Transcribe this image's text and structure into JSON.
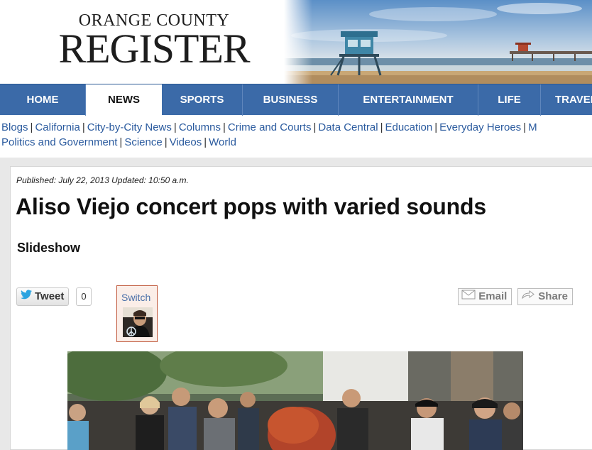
{
  "masthead": {
    "logo_top": "ORANGE COUNTY",
    "logo_bottom": "REGISTER"
  },
  "nav": {
    "items": [
      {
        "label": "HOME",
        "active": false
      },
      {
        "label": "NEWS",
        "active": true
      },
      {
        "label": "SPORTS",
        "active": false
      },
      {
        "label": "BUSINESS",
        "active": false
      },
      {
        "label": "ENTERTAINMENT",
        "active": false
      },
      {
        "label": "LIFE",
        "active": false
      },
      {
        "label": "TRAVEL",
        "active": false
      }
    ]
  },
  "subnav": {
    "links": [
      "Blogs",
      "California",
      "City-by-City News",
      "Columns",
      "Crime and Courts",
      "Data Central",
      "Education",
      "Everyday Heroes",
      "M",
      "Politics and Government",
      "Science",
      "Videos",
      "World"
    ]
  },
  "article": {
    "published_label": "Published:",
    "published_date": "July 22, 2013",
    "updated_label": "Updated:",
    "updated_time": "10:50 a.m.",
    "headline": "Aliso Viejo concert pops with varied sounds",
    "slideshow_label": "Slideshow"
  },
  "social": {
    "tweet_label": "Tweet",
    "tweet_count": "0",
    "switch_label": "Switch",
    "email_label": "Email",
    "share_label": "Share"
  },
  "colors": {
    "nav_bg": "#3b6aa8",
    "link": "#2a5a9e",
    "switch_border": "#c0573a"
  }
}
